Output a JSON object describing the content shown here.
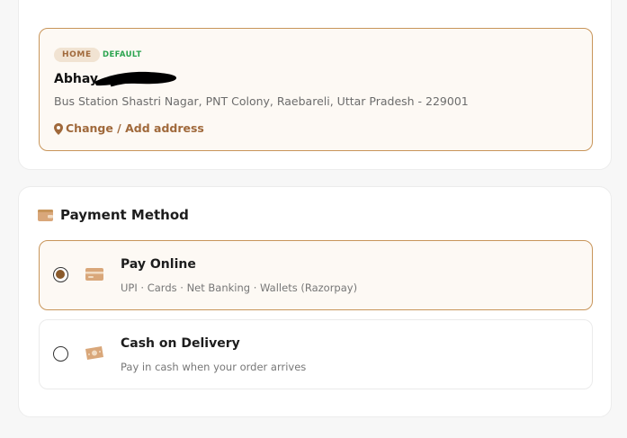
{
  "address": {
    "badge_home": "HOME",
    "badge_default": "DEFAULT",
    "name": "Abhay",
    "line": "Bus Station Shastri Nagar, PNT Colony, Raebareli, Uttar Pradesh - 229001",
    "change_label": "Change / Add address"
  },
  "payment": {
    "title": "Payment Method",
    "options": [
      {
        "title": "Pay Online",
        "subtitle": "UPI · Cards · Net Banking · Wallets (Razorpay)",
        "selected": true,
        "icon": "credit-card-icon"
      },
      {
        "title": "Cash on Delivery",
        "subtitle": "Pay in cash when your order arrives",
        "selected": false,
        "icon": "cash-icon"
      }
    ]
  },
  "colors": {
    "accent": "#a0693b",
    "accent_border": "#c8955a",
    "selected_bg": "#fdf9f4",
    "default_badge": "#2aa44f",
    "icon_tan": "#d9a77a"
  }
}
